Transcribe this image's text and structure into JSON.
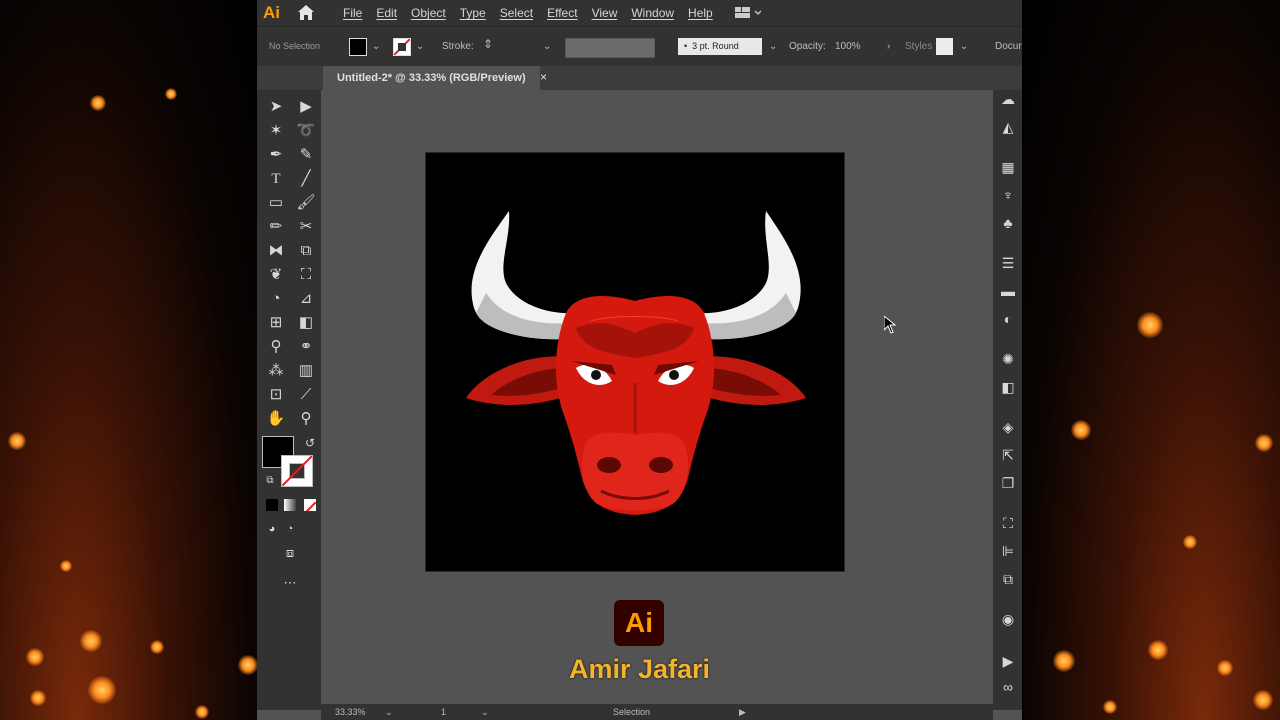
{
  "app": {
    "logo": "Ai"
  },
  "menubar": {
    "items": [
      "File",
      "Edit",
      "Object",
      "Type",
      "Select",
      "Effect",
      "View",
      "Window",
      "Help"
    ]
  },
  "controlbar": {
    "selection": "No Selection",
    "stroke_label": "Stroke:",
    "brush": "3 pt. Round",
    "opacity_label": "Opacity:",
    "opacity_value": "100%",
    "styles_label": "Styles",
    "document_label": "Docum"
  },
  "document_tab": {
    "title": "Untitled-2* @ 33.33% (RGB/Preview)",
    "close": "×"
  },
  "statusbar": {
    "zoom": "33.33%",
    "artboard": "1",
    "tool": "Selection"
  },
  "watermark": {
    "badge": "Ai",
    "name": "Amir Jafari"
  },
  "colors": {
    "brand": "#ff9a00",
    "watermark_text": "#f4b32a",
    "ui_dark": "#323232",
    "canvas": "#535353",
    "bull_red": "#d4190f"
  },
  "icons": {
    "toolbar": [
      "selection-tool-icon",
      "direct-selection-tool-icon",
      "magic-wand-icon",
      "lasso-icon",
      "pen-icon",
      "curvature-icon",
      "type-icon",
      "line-icon",
      "rectangle-icon",
      "paintbrush-icon",
      "pencil-icon",
      "scissors-icon",
      "rotate-icon",
      "scale-icon",
      "warp-icon",
      "free-transform-icon",
      "shape-builder-icon",
      "perspective-icon",
      "mesh-icon",
      "gradient-icon",
      "eyedropper-icon",
      "blend-icon",
      "symbol-sprayer-icon",
      "graph-icon",
      "artboard-icon",
      "slice-icon",
      "hand-icon",
      "zoom-icon"
    ]
  }
}
